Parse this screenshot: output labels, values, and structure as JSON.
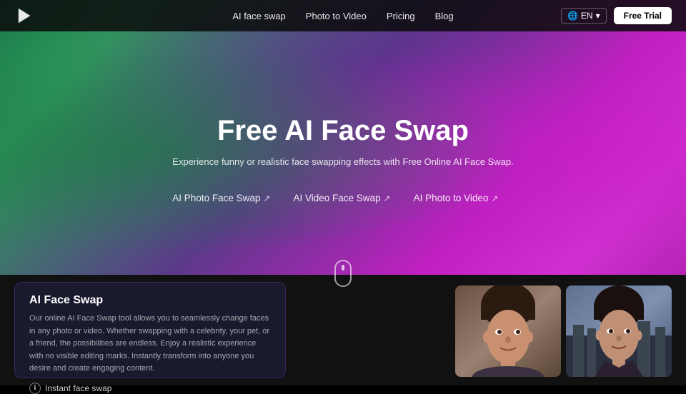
{
  "header": {
    "logo_alt": "Logo",
    "nav": [
      {
        "label": "AI face swap",
        "id": "nav-ai-face-swap"
      },
      {
        "label": "Photo to Video",
        "id": "nav-photo-to-video"
      },
      {
        "label": "Pricing",
        "id": "nav-pricing"
      },
      {
        "label": "Blog",
        "id": "nav-blog"
      }
    ],
    "lang_btn": "EN",
    "free_trial_btn": "Free Trial"
  },
  "hero": {
    "title": "Free AI Face Swap",
    "subtitle": "Experience funny or realistic face swapping effects with Free Online AI Face Swap.",
    "links": [
      {
        "label": "AI Photo Face Swap",
        "arrow": "↗"
      },
      {
        "label": "AI Video Face Swap",
        "arrow": "↗"
      },
      {
        "label": "AI Photo to Video",
        "arrow": "↗"
      }
    ]
  },
  "bottom_card": {
    "title": "AI Face Swap",
    "description": "Our online AI Face Swap tool allows you to seamlessly change faces in any photo or video. Whether swapping with a celebrity, your pet, or a friend, the possibilities are endless. Enjoy a realistic experience with no visible editing marks. Instantly transform into anyone you desire and create engaging content.",
    "instant_link": "Instant face swap"
  }
}
